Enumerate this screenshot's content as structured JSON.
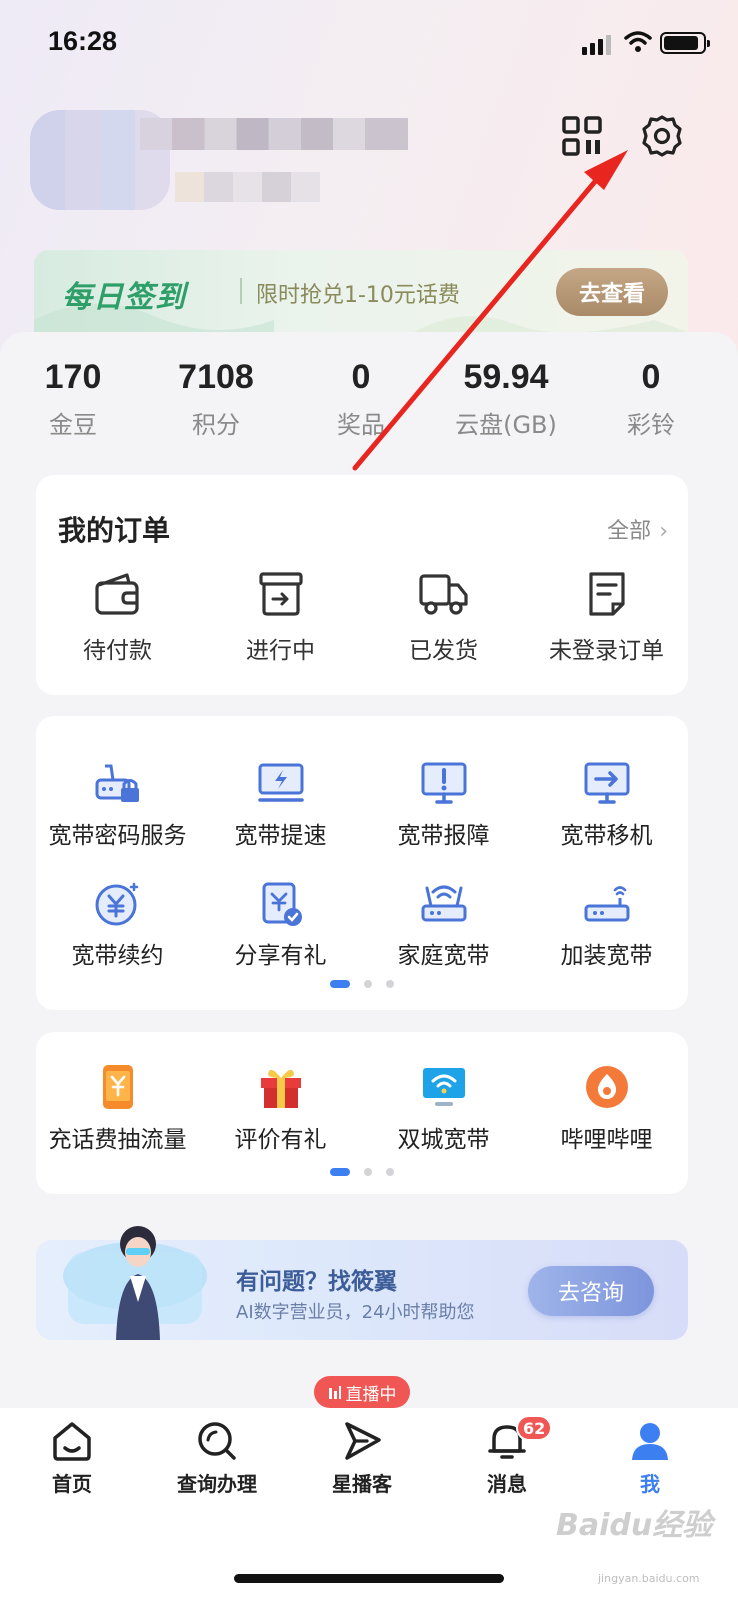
{
  "status_bar": {
    "time": "16:28"
  },
  "header": {
    "qr_icon": "qr-code-icon",
    "settings_icon": "gear-icon"
  },
  "checkin": {
    "title": "每日签到",
    "promo": "限时抢兑1-10元话费",
    "button": "去查看"
  },
  "stats": [
    {
      "value": "170",
      "label": "金豆"
    },
    {
      "value": "7108",
      "label": "积分"
    },
    {
      "value": "0",
      "label": "奖品"
    },
    {
      "value": "59.94",
      "label": "云盘(GB)"
    },
    {
      "value": "0",
      "label": "彩铃"
    }
  ],
  "orders": {
    "title": "我的订单",
    "all_label": "全部",
    "items": [
      {
        "label": "待付款",
        "icon": "wallet-icon"
      },
      {
        "label": "进行中",
        "icon": "box-icon"
      },
      {
        "label": "已发货",
        "icon": "truck-icon"
      },
      {
        "label": "未登录订单",
        "icon": "document-icon"
      }
    ]
  },
  "services": {
    "items": [
      {
        "label": "宽带密码服务",
        "icon": "router-lock-icon"
      },
      {
        "label": "宽带提速",
        "icon": "speed-monitor-icon"
      },
      {
        "label": "宽带报障",
        "icon": "alert-monitor-icon"
      },
      {
        "label": "宽带移机",
        "icon": "move-monitor-icon"
      },
      {
        "label": "宽带续约",
        "icon": "yuan-coin-icon"
      },
      {
        "label": "分享有礼",
        "icon": "share-gift-icon"
      },
      {
        "label": "家庭宽带",
        "icon": "wifi-router-icon"
      },
      {
        "label": "加装宽带",
        "icon": "router-icon"
      }
    ]
  },
  "promos": {
    "items": [
      {
        "label": "充话费抽流量",
        "icon": "phone-yuan-icon"
      },
      {
        "label": "评价有礼",
        "icon": "gift-box-icon"
      },
      {
        "label": "双城宽带",
        "icon": "wifi-screen-icon"
      },
      {
        "label": "哔哩哔哩",
        "icon": "bilibili-icon"
      }
    ]
  },
  "ai_assistant": {
    "title": "有问题？找筱翼",
    "subtitle": "AI数字营业员，24小时帮助您",
    "button": "去咨询"
  },
  "tabbar": {
    "live_badge": "直播中",
    "message_count": "62",
    "items": [
      {
        "label": "首页",
        "icon": "home-icon"
      },
      {
        "label": "查询办理",
        "icon": "search-icon"
      },
      {
        "label": "星播客",
        "icon": "play-arrow-icon"
      },
      {
        "label": "消息",
        "icon": "bell-icon"
      },
      {
        "label": "我",
        "icon": "user-icon"
      }
    ],
    "active_color": "#3b7ff0"
  },
  "watermark": {
    "brand": "Baidu经验",
    "site": "jingyan.baidu.com"
  },
  "colors": {
    "accent": "#3b7ff0",
    "badge_red": "#f05654",
    "checkin_green": "#2f9f6a"
  }
}
